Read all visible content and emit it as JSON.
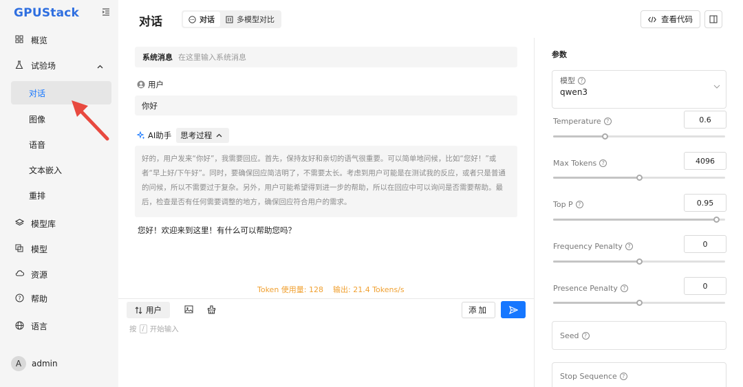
{
  "sidebar": {
    "logo": "GPUStack",
    "items": [
      {
        "label": "概览",
        "icon": "dashboard-icon"
      },
      {
        "label": "试验场",
        "icon": "flask-icon"
      },
      {
        "label": "对话"
      },
      {
        "label": "图像"
      },
      {
        "label": "语音"
      },
      {
        "label": "文本嵌入"
      },
      {
        "label": "重排"
      },
      {
        "label": "模型库",
        "icon": "layers-icon"
      },
      {
        "label": "模型",
        "icon": "model-icon"
      },
      {
        "label": "资源",
        "icon": "cloud-icon"
      },
      {
        "label": "帮助",
        "icon": "help-icon"
      },
      {
        "label": "语言",
        "icon": "globe-icon"
      }
    ],
    "active_item": "对话",
    "user": {
      "initial": "A",
      "name": "admin"
    }
  },
  "header": {
    "title": "对话",
    "tabs": [
      {
        "label": "对话",
        "active": true
      },
      {
        "label": "多模型对比",
        "active": false
      }
    ],
    "view_code_label": "查看代码"
  },
  "chat": {
    "system_label": "系统消息",
    "system_placeholder": "在这里输入系统消息",
    "user_role": "用户",
    "user_message": "你好",
    "assistant_role": "AI助手",
    "thinking_label": "思考过程",
    "thinking_text": "好的，用户发来“你好”，我需要回应。首先，保持友好和亲切的语气很重要。可以简单地问候，比如“您好！”或者“早上好/下午好”。同时，要确保回应简洁明了，不需要太长。考虑到用户可能是在测试我的反应，或者只是普通的问候，所以不需要过于复杂。另外，用户可能希望得到进一步的帮助，所以在回应中可以询问是否需要帮助。最后，检查是否有任何需要调整的地方，确保回应符合用户的需求。",
    "assistant_message": "您好！欢迎来到这里！有什么可以帮助您吗？",
    "token_usage": "Token 使用量: 128",
    "output_speed": "输出: 21.4 Tokens/s"
  },
  "input": {
    "role_label": "用户",
    "add_label": "添加",
    "hint_prefix": "按",
    "hint_key": "/",
    "hint_suffix": "开始输入"
  },
  "params": {
    "title": "参数",
    "model_label": "模型",
    "model_value": "qwen3",
    "temperature": {
      "label": "Temperature",
      "value": "0.6",
      "fraction": 0.3
    },
    "max_tokens": {
      "label": "Max Tokens",
      "value": "4096",
      "fraction": 0.5
    },
    "top_p": {
      "label": "Top P",
      "value": "0.95",
      "fraction": 0.95
    },
    "frequency_penalty": {
      "label": "Frequency Penalty",
      "value": "0",
      "fraction": 0.5
    },
    "presence_penalty": {
      "label": "Presence Penalty",
      "value": "0",
      "fraction": 0.5
    },
    "seed_label": "Seed",
    "stop_label": "Stop Sequence"
  },
  "colors": {
    "accent": "#1677ff",
    "token_stat": "#f0a030",
    "annotation_arrow": "#e8493f"
  }
}
